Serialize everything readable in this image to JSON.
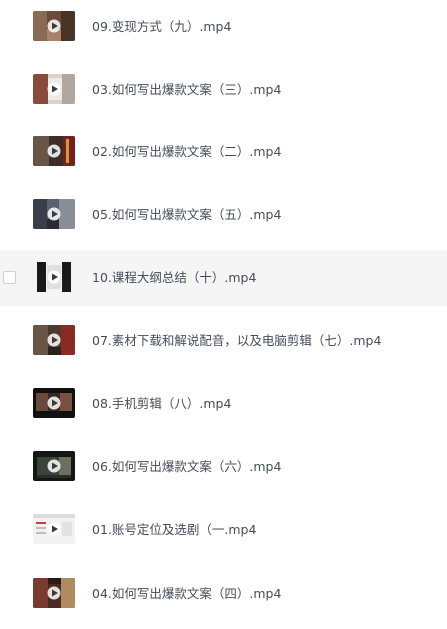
{
  "files": [
    {
      "name": "09.变现方式（九）.mp4",
      "thumb": "video-thumbnail-icon",
      "play": "play-icon"
    },
    {
      "name": "03.如何写出爆款文案（三）.mp4",
      "thumb": "video-thumbnail-icon",
      "play": "play-icon"
    },
    {
      "name": "02.如何写出爆款文案（二）.mp4",
      "thumb": "video-thumbnail-icon",
      "play": "play-icon"
    },
    {
      "name": "05.如何写出爆款文案（五）.mp4",
      "thumb": "video-thumbnail-icon",
      "play": "play-icon"
    },
    {
      "name": "10.课程大纲总结（十）.mp4",
      "thumb": "video-thumbnail-icon",
      "play": "play-icon",
      "hovered": true
    },
    {
      "name": "07.素材下载和解说配音，以及电脑剪辑（七）.mp4",
      "thumb": "video-thumbnail-icon",
      "play": "play-icon"
    },
    {
      "name": "08.手机剪辑（八）.mp4",
      "thumb": "video-thumbnail-icon",
      "play": "play-icon"
    },
    {
      "name": "06.如何写出爆款文案（六）.mp4",
      "thumb": "video-thumbnail-icon",
      "play": "play-icon"
    },
    {
      "name": "01.账号定位及选剧（一.mp4",
      "thumb": "video-thumbnail-icon",
      "play": "play-icon"
    },
    {
      "name": "04.如何写出爆款文案（四）.mp4",
      "thumb": "video-thumbnail-icon",
      "play": "play-icon"
    }
  ]
}
